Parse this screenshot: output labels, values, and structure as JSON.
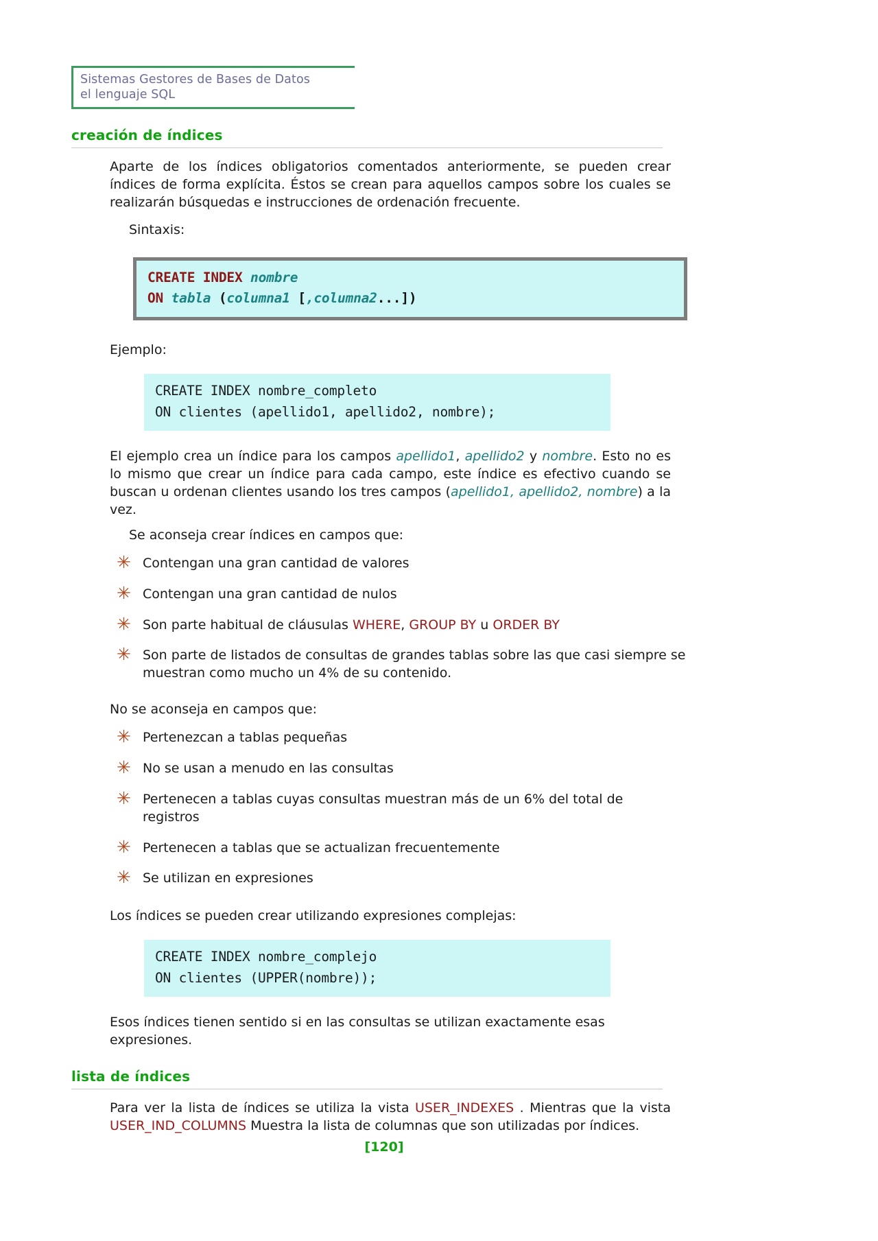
{
  "header": {
    "line1": "Sistemas Gestores de Bases de Datos",
    "line2": "el lenguaje SQL"
  },
  "sections": {
    "creacion": {
      "title": "creación de índices",
      "intro": "Aparte de los índices obligatorios comentados anteriormente, se pueden crear índices de forma explícita. Éstos se crean para aquellos campos sobre los cuales se realizarán búsquedas e instrucciones de ordenación frecuente.",
      "sintaxis_label": "Sintaxis:",
      "ejemplo_label": "Ejemplo:",
      "syntax_code": {
        "line1_kw": "CREATE INDEX ",
        "line1_var": "nombre",
        "line2_kw": "ON ",
        "line2_var_a": "tabla ",
        "line2_punc_a": "(",
        "line2_var_b": "columna1 ",
        "line2_punc_b": "[",
        "line2_var_c": ",columna2",
        "line2_punc_c": "...])"
      },
      "example_code": {
        "line1": "CREATE INDEX nombre_completo",
        "line2": "ON clientes (apellido1, apellido2, nombre);"
      },
      "after_example_p1_a": "El ejemplo crea un índice para los campos ",
      "after_example_f1": "apellido1",
      "after_example_p1_b": ", ",
      "after_example_f2": "apellido2",
      "after_example_p1_c": " y ",
      "after_example_f3": "nombre",
      "after_example_p1_d": ". Esto no es lo mismo que crear un índice para cada campo, este índice es efectivo cuando se buscan u ordenan clientes usando los tres campos (",
      "after_example_f4": "apellido1, apellido2, nombre",
      "after_example_p1_e": ") a la vez.",
      "advise_label": "Se aconseja crear índices en campos que:",
      "advise_items": [
        {
          "text": "Contengan una gran cantidad de valores"
        },
        {
          "text": "Contengan una gran cantidad de nulos"
        },
        {
          "prefix": "Son parte habitual de cláusulas ",
          "kw1": "WHERE",
          "mid1": ", ",
          "kw2": "GROUP BY",
          "mid2": " u ",
          "kw3": "ORDER BY"
        },
        {
          "text": "Son parte de listados de consultas de grandes tablas sobre las que casi siempre se muestran como mucho un 4% de su contenido."
        }
      ],
      "not_advise_label": "No se aconseja en campos que:",
      "not_advise_items": [
        {
          "text": "Pertenezcan a tablas pequeñas"
        },
        {
          "text": "No se usan a menudo en las consultas"
        },
        {
          "text": "Pertenecen a tablas cuyas consultas muestran más de un 6% del total de registros"
        },
        {
          "text": "Pertenecen a tablas que se actualizan frecuentemente"
        },
        {
          "text": "Se utilizan en expresiones"
        }
      ],
      "complex_intro": "Los índices se pueden crear utilizando expresiones complejas:",
      "complex_code": {
        "line1": "CREATE INDEX nombre_complejo",
        "line2": "ON clientes (UPPER(nombre));"
      },
      "complex_outro": "Esos índices tienen sentido si en las consultas se utilizan exactamente esas expresiones."
    },
    "lista": {
      "title": "lista de índices",
      "p1_a": "Para ver la lista de índices se utiliza la vista ",
      "p1_kw1": "USER_INDEXES",
      "p1_b": " . Mientras que la vista ",
      "p1_kw2": "USER_IND_COLUMNS",
      "p1_c": " Muestra la lista de columnas que son utilizadas por índices."
    }
  },
  "footer": {
    "page_number": "[120]"
  },
  "icons": {
    "bullet_star": "✳"
  },
  "colors": {
    "heading_green": "#12a312",
    "header_border_green": "#3a9d5d",
    "header_text_purple": "#6b6d99",
    "code_bg_cyan": "#cdf7f7",
    "code_frame_gray": "#7d7d7d",
    "sql_keyword_red": "#9b1b1b",
    "field_teal": "#1a7f7f",
    "bullet_rust": "#b1451b"
  }
}
